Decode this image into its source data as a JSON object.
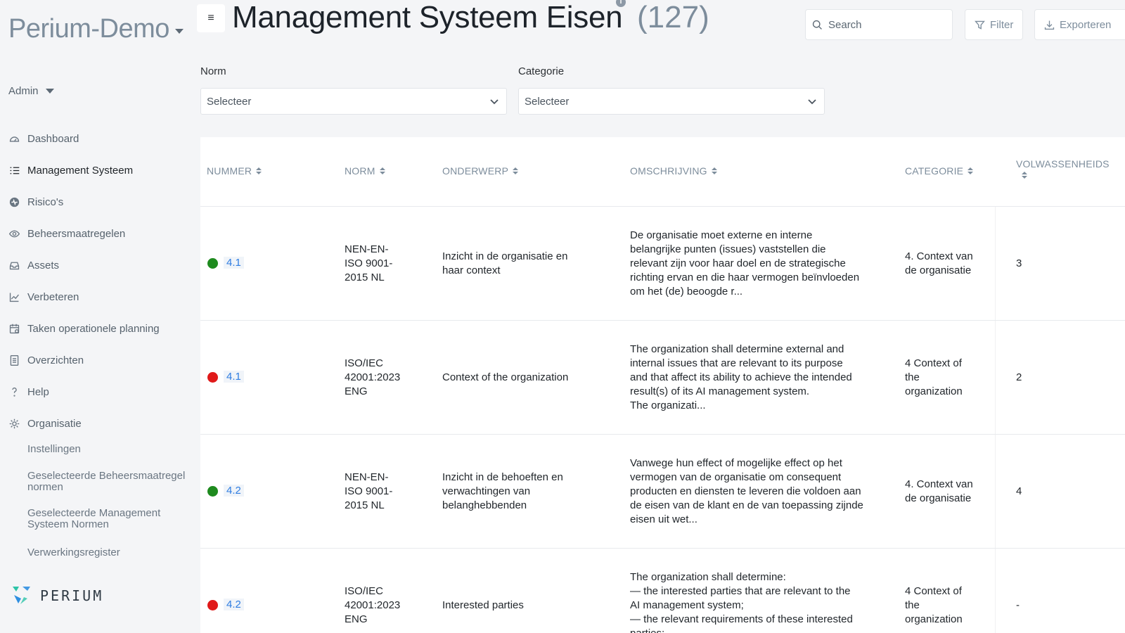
{
  "app": {
    "brand": "Perium-Demo",
    "user": "Admin",
    "logo_text": "PERIUM"
  },
  "sidebar": {
    "items": [
      {
        "label": "Dashboard",
        "icon": "dashboard-icon"
      },
      {
        "label": "Management Systeem",
        "icon": "list-icon",
        "active": true
      },
      {
        "label": "Risico's",
        "icon": "risk-icon"
      },
      {
        "label": "Beheersmaatregelen",
        "icon": "eye-icon"
      },
      {
        "label": "Assets",
        "icon": "inbox-icon"
      },
      {
        "label": "Verbeteren",
        "icon": "chart-line-icon"
      },
      {
        "label": "Taken operationele planning",
        "icon": "calendar-icon"
      },
      {
        "label": "Overzichten",
        "icon": "document-icon"
      },
      {
        "label": "Help",
        "icon": "question-icon"
      },
      {
        "label": "Organisatie",
        "icon": "gear-icon"
      }
    ],
    "subitems": [
      "Instellingen",
      "Geselecteerde Beheersmaatregel normen",
      "Geselecteerde Management Systeem Normen",
      "Verwerkingsregister"
    ]
  },
  "header": {
    "title": "Management Systeem Eisen",
    "count": "(127)",
    "search_placeholder": "Search",
    "filter_label": "Filter",
    "export_label": "Exporteren"
  },
  "filters": {
    "norm": {
      "label": "Norm",
      "value": "Selecteer"
    },
    "categorie": {
      "label": "Categorie",
      "value": "Selecteer"
    }
  },
  "table": {
    "columns": [
      "NUMMER",
      "NORM",
      "ONDERWERP",
      "OMSCHRIJVING",
      "CATEGORIE",
      "VOLWASSENHEIDS"
    ],
    "rows": [
      {
        "status": "green",
        "status_color": "#1e8a1e",
        "nummer": "4.1",
        "norm": [
          "NEN-EN-",
          "ISO 9001-",
          "2015 NL"
        ],
        "onderwerp": [
          "Inzicht in de organisatie en",
          "haar context"
        ],
        "omschrijving": [
          "De organisatie moet externe en interne",
          "belangrijke punten (issues) vaststellen die",
          "relevant zijn voor haar doel en de strategische",
          "richting ervan en die haar vermogen beïnvloeden",
          "om het (de) beoogde r..."
        ],
        "categorie": [
          "4. Context van",
          "de organisatie"
        ],
        "volwassenheid": "3"
      },
      {
        "status": "red",
        "status_color": "#e01919",
        "nummer": "4.1",
        "norm": [
          "ISO/IEC",
          "42001:2023",
          "ENG"
        ],
        "onderwerp": [
          "Context of the organization"
        ],
        "omschrijving": [
          "The organization shall determine external and",
          "internal issues that are relevant to its purpose",
          "and that affect its ability to achieve the intended",
          "result(s) of its AI management system.",
          "The organizati..."
        ],
        "categorie": [
          "4 Context of",
          "the",
          "organization"
        ],
        "volwassenheid": "2"
      },
      {
        "status": "green",
        "status_color": "#1e8a1e",
        "nummer": "4.2",
        "norm": [
          "NEN-EN-",
          "ISO 9001-",
          "2015 NL"
        ],
        "onderwerp": [
          "Inzicht in de behoeften en",
          "verwachtingen van",
          "belanghebbenden"
        ],
        "omschrijving": [
          "Vanwege hun effect of mogelijke effect op het",
          "vermogen van de organisatie om consequent",
          "producten en diensten te leveren die voldoen aan",
          "de eisen van de klant en de van toepassing zijnde",
          "eisen uit wet..."
        ],
        "categorie": [
          "4. Context van",
          "de organisatie"
        ],
        "volwassenheid": "4"
      },
      {
        "status": "red",
        "status_color": "#e01919",
        "nummer": "4.2",
        "norm": [
          "ISO/IEC",
          "42001:2023",
          "ENG"
        ],
        "onderwerp": [
          "Interested parties"
        ],
        "omschrijving": [
          "The organization shall determine:",
          "— the interested parties that are relevant to the",
          "AI management system;",
          "— the relevant requirements of these interested",
          "parties;"
        ],
        "categorie": [
          "4 Context of",
          "the",
          "organization"
        ],
        "volwassenheid": "-"
      }
    ]
  }
}
